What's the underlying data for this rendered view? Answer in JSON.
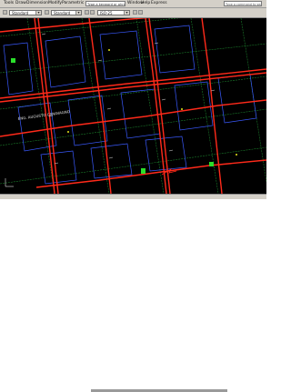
{
  "menu": {
    "items": [
      "Tools",
      "Draw",
      "Dimension",
      "Modify",
      "Parametric",
      "Window",
      "Help",
      "Express"
    ],
    "title_text": "Type a keyword or phrase",
    "help_text": "Type a command to search"
  },
  "toolbar": {
    "text_style": "Standard",
    "dim_style": "Standard",
    "layer_value": "ISO-25"
  },
  "drawing": {
    "street_label": "ENG. AUGUSTO CANAVAGNO"
  },
  "colors": {
    "road": "#ff2a1a",
    "parcel": "#1a7a2a",
    "block": "#3a5aff",
    "annotation": "#e0e0e0",
    "marker": "#e6e61a",
    "tag": "#2adf2a"
  }
}
